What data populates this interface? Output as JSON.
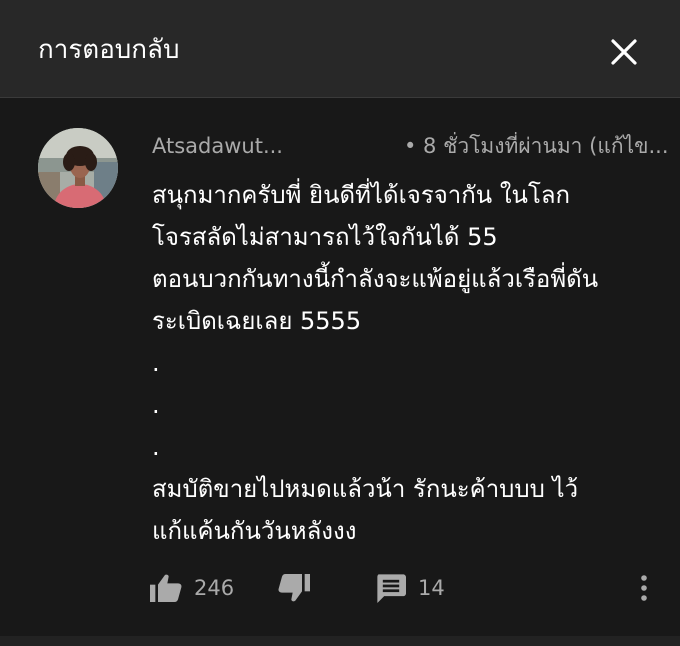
{
  "header": {
    "title": "การตอบกลับ",
    "close_icon": "close-icon"
  },
  "comment": {
    "author": "Atsadawut...",
    "meta": "• 8 ชั่วโมงที่ผ่านมา (แก้ไข...",
    "body_lines": [
      "สนุกมากครับพี่ ยินดีที่ได้เจรจากัน ในโลก",
      "โจรสลัดไม่สามารถไว้ใจกันได้ 55",
      "ตอนบวกกันทางนี้กำลังจะแพ้อยู่แล้วเรือพี่ดัน",
      "ระเบิดเฉยเลย 5555",
      ".",
      ".",
      ".",
      "สมบัติขายไปหมดแล้วน้า รักนะค้าบบบ ไว้",
      "แก้แค้นกันวันหลังงง"
    ],
    "likes": "246",
    "replies": "14"
  },
  "colors": {
    "background": "#181818",
    "header_bg": "#282828",
    "text_primary": "#ffffff",
    "text_secondary": "#aaaaaa"
  },
  "icons": {
    "like": "thumb-up-icon",
    "dislike": "thumb-down-icon",
    "reply": "comment-icon",
    "more": "more-vert-icon"
  }
}
